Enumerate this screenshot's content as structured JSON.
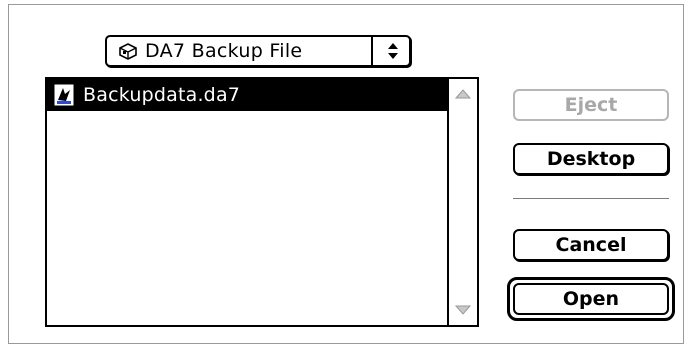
{
  "folder_popup": {
    "label": "DA7 Backup File",
    "icon": "disk-icon"
  },
  "file_list": {
    "items": [
      {
        "name": "Backupdata.da7",
        "icon": "document-icon",
        "selected": true
      }
    ]
  },
  "buttons": {
    "eject": "Eject",
    "desktop": "Desktop",
    "cancel": "Cancel",
    "open": "Open"
  },
  "colors": {
    "selection": "#000000",
    "disabled_text": "#a8a8a8"
  }
}
